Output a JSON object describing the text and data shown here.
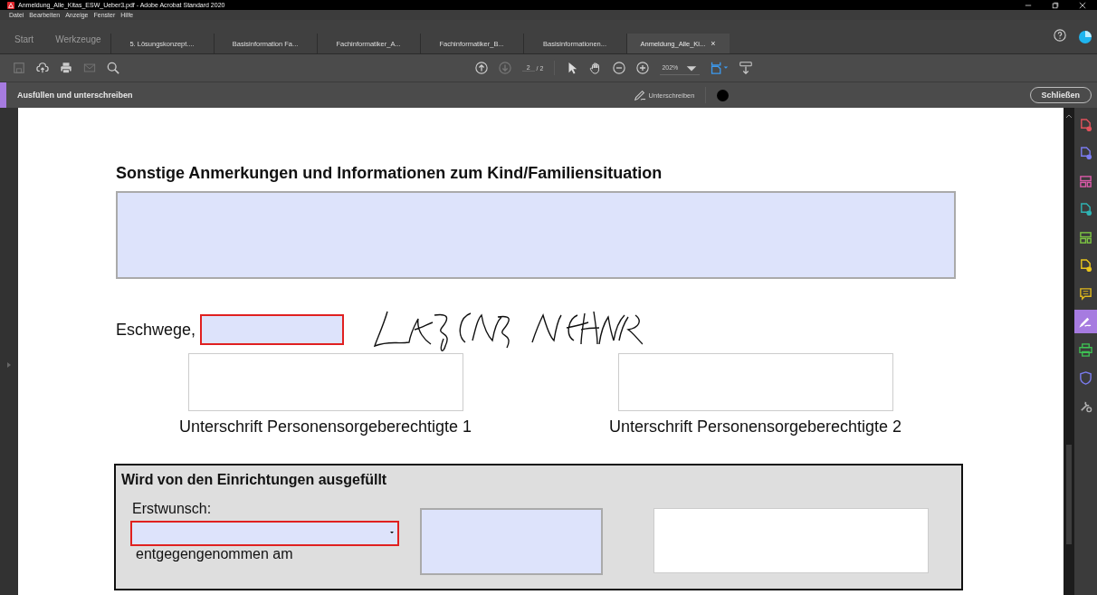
{
  "window": {
    "title": "Anmeldung_Alle_Kitas_ESW_Ueber3.pdf - Adobe Acrobat Standard 2020"
  },
  "menu": [
    "Datei",
    "Bearbeiten",
    "Anzeige",
    "Fenster",
    "Hilfe"
  ],
  "nav": [
    "Start",
    "Werkzeuge"
  ],
  "tabs": [
    {
      "label": "5. Lösungskonzept....",
      "selected": false
    },
    {
      "label": "Basisinformation Fa...",
      "selected": false
    },
    {
      "label": "Fachinformatiker_A...",
      "selected": false
    },
    {
      "label": "Fachinformatiker_B...",
      "selected": false
    },
    {
      "label": "Basisinformationen...",
      "selected": false
    },
    {
      "label": "Anmeldung_Alle_Ki...",
      "selected": true,
      "close": "×"
    }
  ],
  "toolbar": {
    "page": "2",
    "page_total": "/ 2",
    "zoom": "202%"
  },
  "fill_sign": {
    "title": "Ausfüllen und unterschreiben",
    "sign": "Unterschreiben",
    "close": "Schließen"
  },
  "tools_panel": [
    {
      "selected": false
    },
    {
      "selected": false
    },
    {
      "selected": false
    },
    {
      "selected": false
    },
    {
      "selected": false
    },
    {
      "selected": false
    },
    {
      "selected": false
    },
    {
      "selected": true
    },
    {
      "selected": false
    },
    {
      "selected": false
    },
    {
      "selected": false
    }
  ],
  "document": {
    "heading": "Sonstige Anmerkungen und Informationen zum Kind/Familiensituation",
    "place_label": "Eschwege,",
    "date_field": {
      "required": true
    },
    "signatures": [
      {
        "label": "Unterschrift Personensorgeberechtigte 1"
      },
      {
        "label": "Unterschrift Personensorgeberechtigte 2"
      }
    ],
    "office": {
      "heading": "Wird von den Einrichtungen ausgefüllt",
      "first_choice_label": "Erstwunsch:",
      "first_choice_field": {
        "required": true
      },
      "received_label": "entgegengenommen am"
    }
  }
}
